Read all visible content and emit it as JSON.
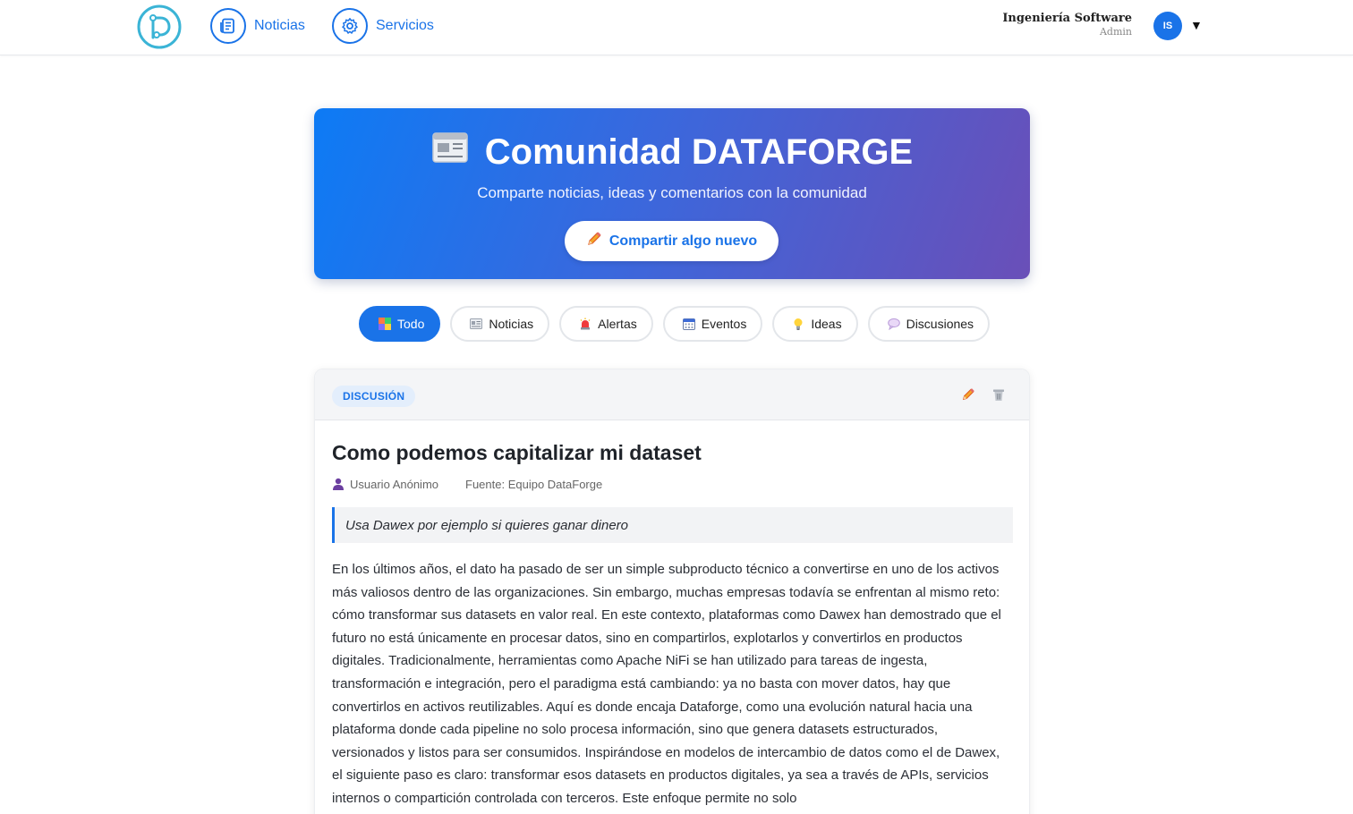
{
  "nav": {
    "noticias_label": "Noticias",
    "servicios_label": "Servicios",
    "user_name": "Ingeniería Software",
    "user_role": "Admin",
    "avatar_initials": "IS",
    "caret": "▼"
  },
  "hero": {
    "title": "Comunidad DATAFORGE",
    "subtitle": "Comparte noticias, ideas y comentarios con la comunidad",
    "button_label": "Compartir algo nuevo"
  },
  "filters": [
    {
      "label": "Todo",
      "icon": "all-icon",
      "active": true
    },
    {
      "label": "Noticias",
      "icon": "newspaper-icon",
      "active": false
    },
    {
      "label": "Alertas",
      "icon": "siren-icon",
      "active": false
    },
    {
      "label": "Eventos",
      "icon": "calendar-icon",
      "active": false
    },
    {
      "label": "Ideas",
      "icon": "lightbulb-icon",
      "active": false
    },
    {
      "label": "Discusiones",
      "icon": "speech-bubble-icon",
      "active": false
    }
  ],
  "post": {
    "badge": "DISCUSIÓN",
    "title": "Como podemos capitalizar mi dataset",
    "author": "Usuario Anónimo",
    "source": "Fuente: Equipo DataForge",
    "quote": "Usa Dawex por ejemplo si quieres ganar dinero",
    "body": "En los últimos años, el dato ha pasado de ser un simple subproducto técnico a convertirse en uno de los activos más valiosos dentro de las organizaciones. Sin embargo, muchas empresas todavía se enfrentan al mismo reto: cómo transformar sus datasets en valor real. En este contexto, plataformas como Dawex han demostrado que el futuro no está únicamente en procesar datos, sino en compartirlos, explotarlos y convertirlos en productos digitales. Tradicionalmente, herramientas como Apache NiFi se han utilizado para tareas de ingesta, transformación e integración, pero el paradigma está cambiando: ya no basta con mover datos, hay que convertirlos en activos reutilizables. Aquí es donde encaja Dataforge, como una evolución natural hacia una plataforma donde cada pipeline no solo procesa información, sino que genera datasets estructurados, versionados y listos para ser consumidos. Inspirándose en modelos de intercambio de datos como el de Dawex, el siguiente paso es claro: transformar esos datasets en productos digitales, ya sea a través de APIs, servicios internos o compartición controlada con terceros. Este enfoque permite no solo"
  },
  "colors": {
    "accent": "#1a73e8",
    "hero_gradient_start": "#0d7bf5",
    "hero_gradient_end": "#6a4fb8"
  }
}
